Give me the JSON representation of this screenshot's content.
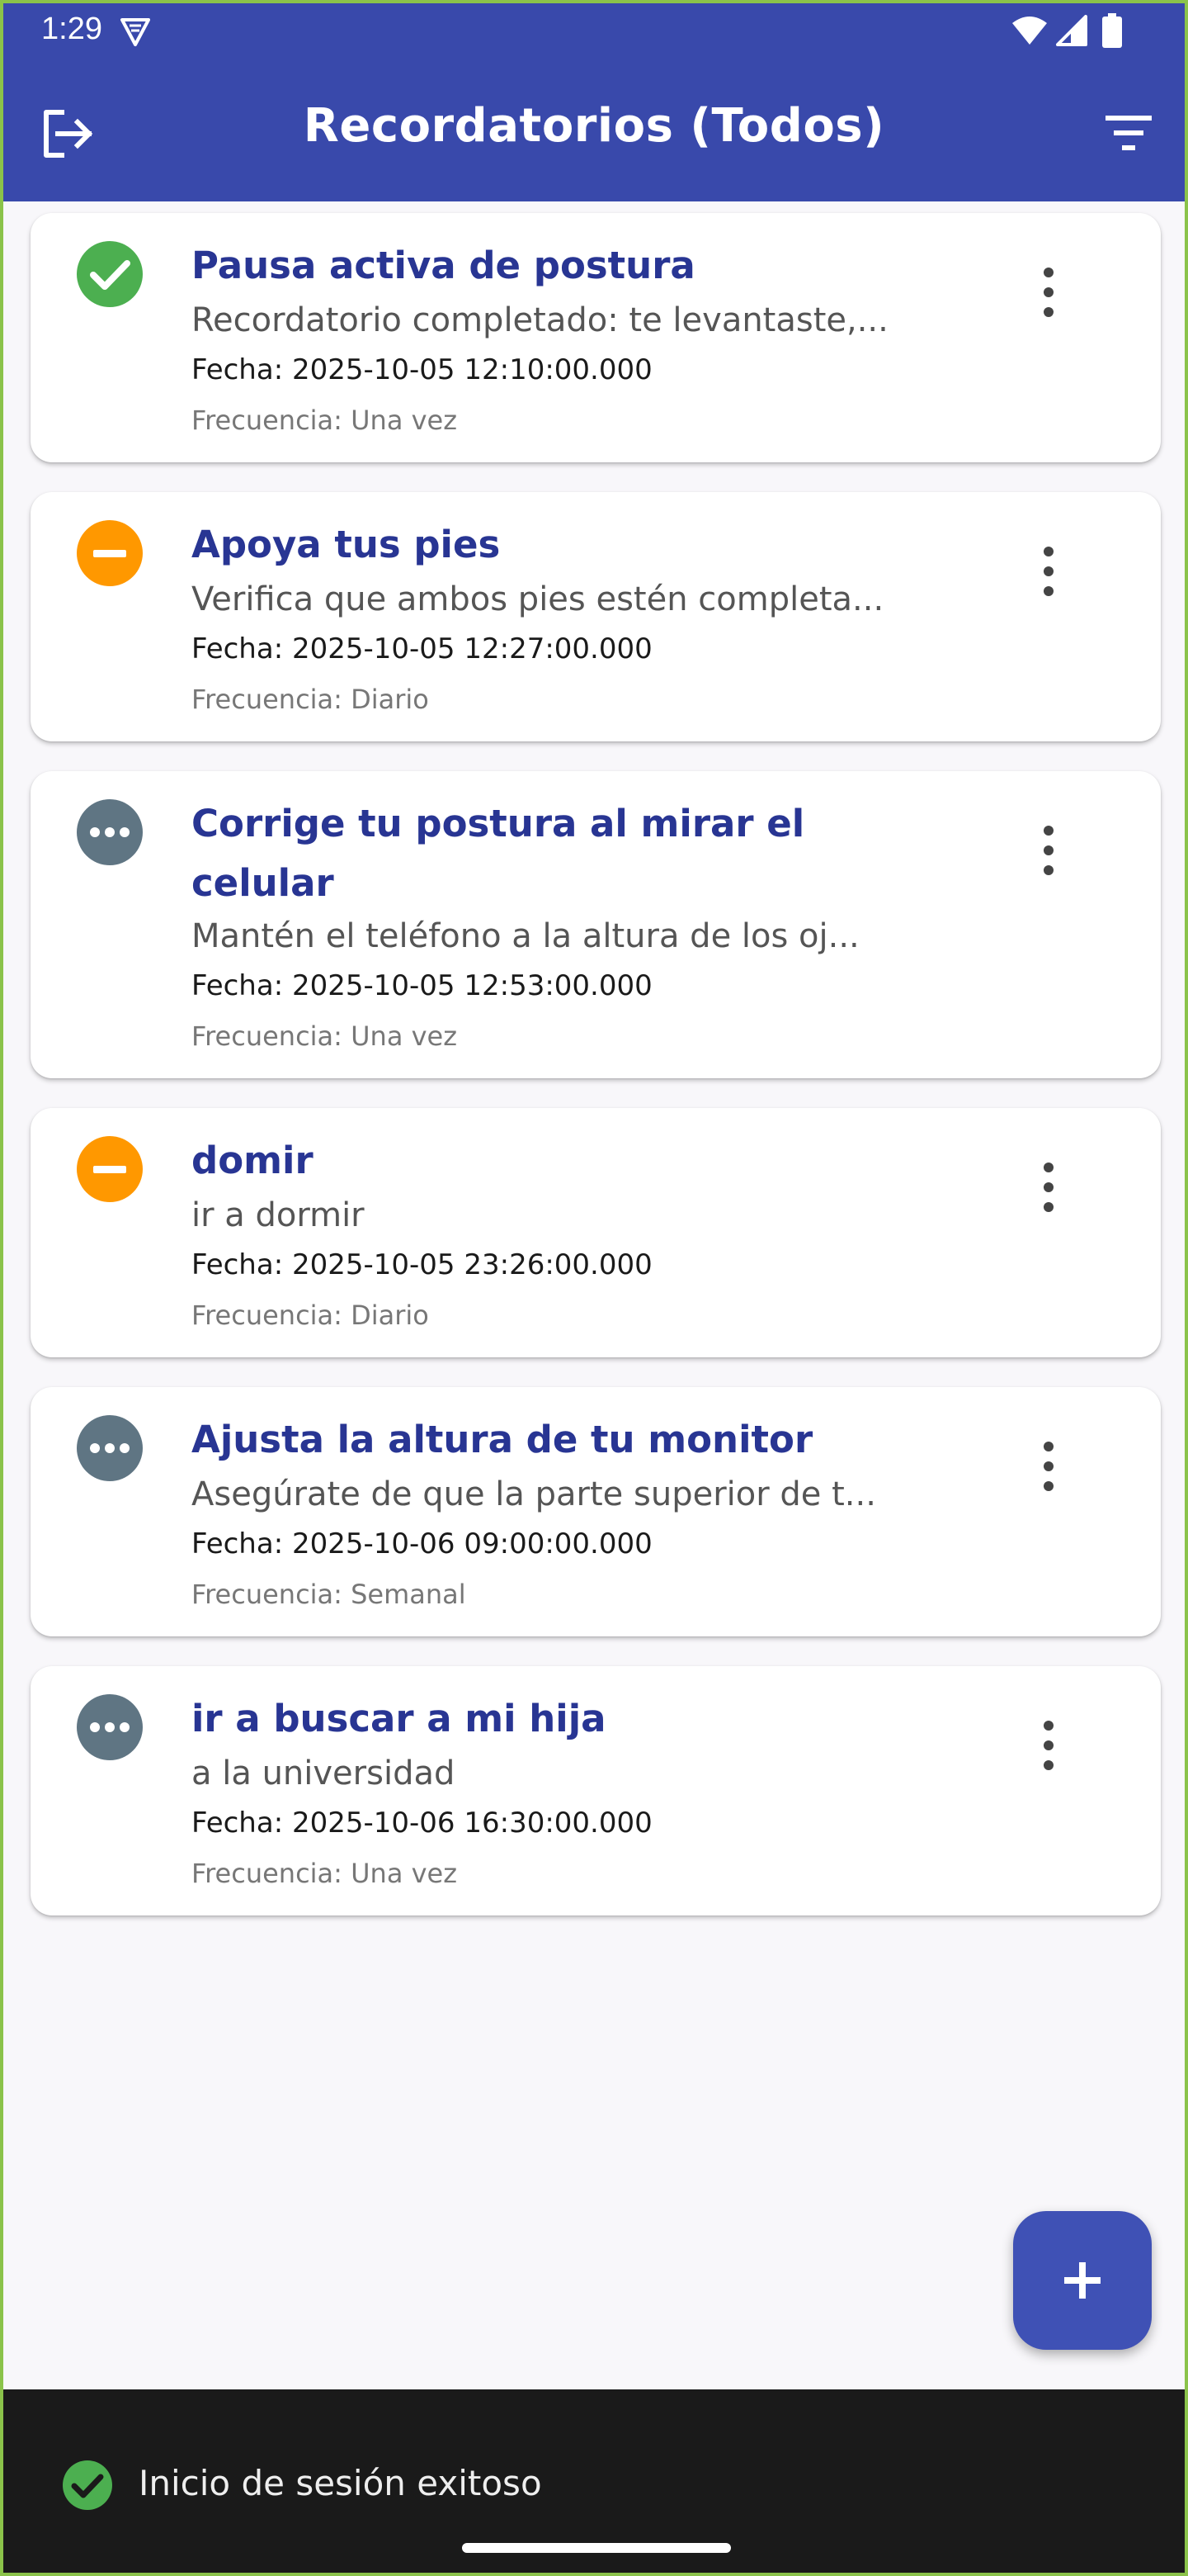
{
  "status_bar": {
    "time": "1:29"
  },
  "app_bar": {
    "title": "Recordatorios (Todos)"
  },
  "reminders": [
    {
      "status": "completed",
      "status_color": "#4CAF50",
      "title": "Pausa activa de postura",
      "description": "Recordatorio completado: te levantaste,...",
      "date": "Fecha: 2025-10-05 12:10:00.000",
      "frequency": "Frecuencia: Una vez"
    },
    {
      "status": "skipped",
      "status_color": "#FF9800",
      "title": "Apoya tus pies",
      "description": "Verifica que ambos pies estén completa...",
      "date": "Fecha: 2025-10-05 12:27:00.000",
      "frequency": "Frecuencia: Diario"
    },
    {
      "status": "pending",
      "status_color": "#5F7583",
      "title": "Corrige tu postura al mirar el celular",
      "description": "Mantén el teléfono a la altura de los oj...",
      "date": "Fecha: 2025-10-05 12:53:00.000",
      "frequency": "Frecuencia: Una vez"
    },
    {
      "status": "skipped",
      "status_color": "#FF9800",
      "title": "domir",
      "description": "ir a dormir",
      "date": "Fecha: 2025-10-05 23:26:00.000",
      "frequency": "Frecuencia: Diario"
    },
    {
      "status": "pending",
      "status_color": "#5F7583",
      "title": "Ajusta la altura de tu monitor",
      "description": "Asegúrate de que la parte superior de t...",
      "date": "Fecha: 2025-10-06 09:00:00.000",
      "frequency": "Frecuencia: Semanal"
    },
    {
      "status": "pending",
      "status_color": "#5F7583",
      "title": "ir a buscar a mi hija",
      "description": "a la universidad",
      "date": "Fecha: 2025-10-06 16:30:00.000",
      "frequency": "Frecuencia: Una vez"
    }
  ],
  "snackbar": {
    "message": "Inicio de sesión exitoso"
  },
  "colors": {
    "primary": "#3949AB",
    "title_text": "#283593",
    "fab": "#3F51B5"
  }
}
